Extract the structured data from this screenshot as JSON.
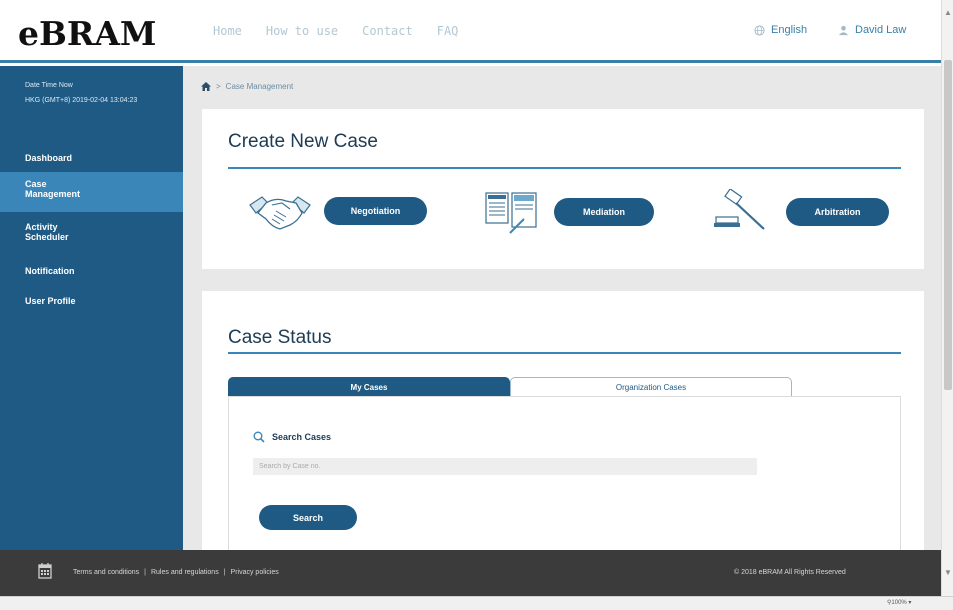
{
  "header": {
    "logo": "eBRAM",
    "nav": [
      "Home",
      "How to use",
      "Contact",
      "FAQ"
    ],
    "language": "English",
    "user": "David Law"
  },
  "sidebar": {
    "datetime_label": "Date Time Now",
    "datetime_value": "HKG (GMT+8) 2019-02-04 13:04:23",
    "items": [
      {
        "label": "Dashboard"
      },
      {
        "label": "Case Management"
      },
      {
        "label": "Activity Scheduler"
      },
      {
        "label": "Notification"
      },
      {
        "label": "User Profile"
      }
    ]
  },
  "breadcrumb": {
    "separator": ">",
    "current": "Case Management"
  },
  "create_case": {
    "title": "Create New Case",
    "types": [
      {
        "label": "Negotiation",
        "icon": "handshake-icon"
      },
      {
        "label": "Mediation",
        "icon": "document-sign-icon"
      },
      {
        "label": "Arbitration",
        "icon": "gavel-icon"
      }
    ]
  },
  "case_status": {
    "title": "Case Status",
    "tabs": [
      {
        "label": "My Cases",
        "active": true
      },
      {
        "label": "Organization Cases",
        "active": false
      }
    ],
    "search_label": "Search Cases",
    "search_placeholder": "Search by Case no.",
    "search_button": "Search"
  },
  "footer": {
    "links": [
      "Terms and conditions",
      "Rules and regulations",
      "Privacy policies"
    ],
    "separator": "|",
    "copyright": "© 2018 eBRAM All Rights Reserved"
  },
  "statusbar": {
    "zoom": "100%"
  },
  "colors": {
    "primary": "#1f5a84",
    "accent": "#3a86b9",
    "footer": "#3b3b3b"
  }
}
